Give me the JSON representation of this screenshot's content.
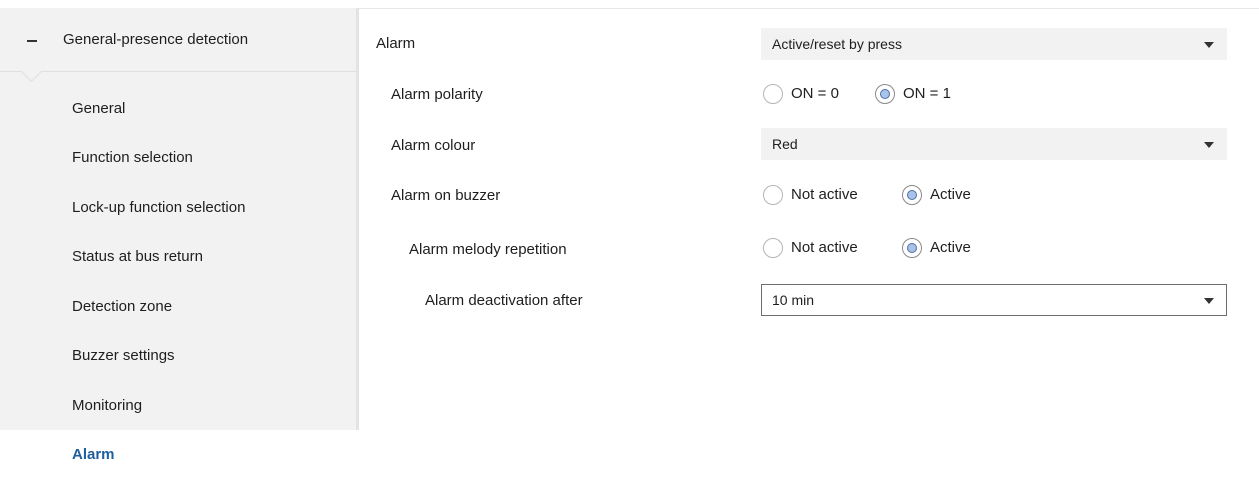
{
  "sidebar": {
    "group_title": "General-presence detection",
    "items": [
      {
        "label": "General"
      },
      {
        "label": "Function selection"
      },
      {
        "label": "Lock-up function selection"
      },
      {
        "label": "Status at bus return"
      },
      {
        "label": "Detection zone"
      },
      {
        "label": "Buzzer settings"
      },
      {
        "label": "Monitoring"
      },
      {
        "label": "Alarm"
      }
    ],
    "active_item": "Alarm"
  },
  "form": {
    "alarm": {
      "label": "Alarm",
      "value": "Active/reset by press"
    },
    "alarm_polarity": {
      "label": "Alarm polarity",
      "options": [
        "ON = 0",
        "ON = 1"
      ],
      "selected": "ON = 1"
    },
    "alarm_colour": {
      "label": "Alarm colour",
      "value": "Red"
    },
    "alarm_on_buzzer": {
      "label": "Alarm on buzzer",
      "options": [
        "Not active",
        "Active"
      ],
      "selected": "Active"
    },
    "alarm_melody_repetition": {
      "label": "Alarm melody repetition",
      "options": [
        "Not active",
        "Active"
      ],
      "selected": "Active"
    },
    "alarm_deactivation_after": {
      "label": "Alarm deactivation after",
      "value": "10 min"
    }
  },
  "icons": {
    "collapse": "minus-icon",
    "dropdown": "chevron-down-icon"
  },
  "colors": {
    "accent": "#1f5f9e",
    "sidebar_bg": "#f2f2f2",
    "radio_fill": "#a8c2e8"
  }
}
